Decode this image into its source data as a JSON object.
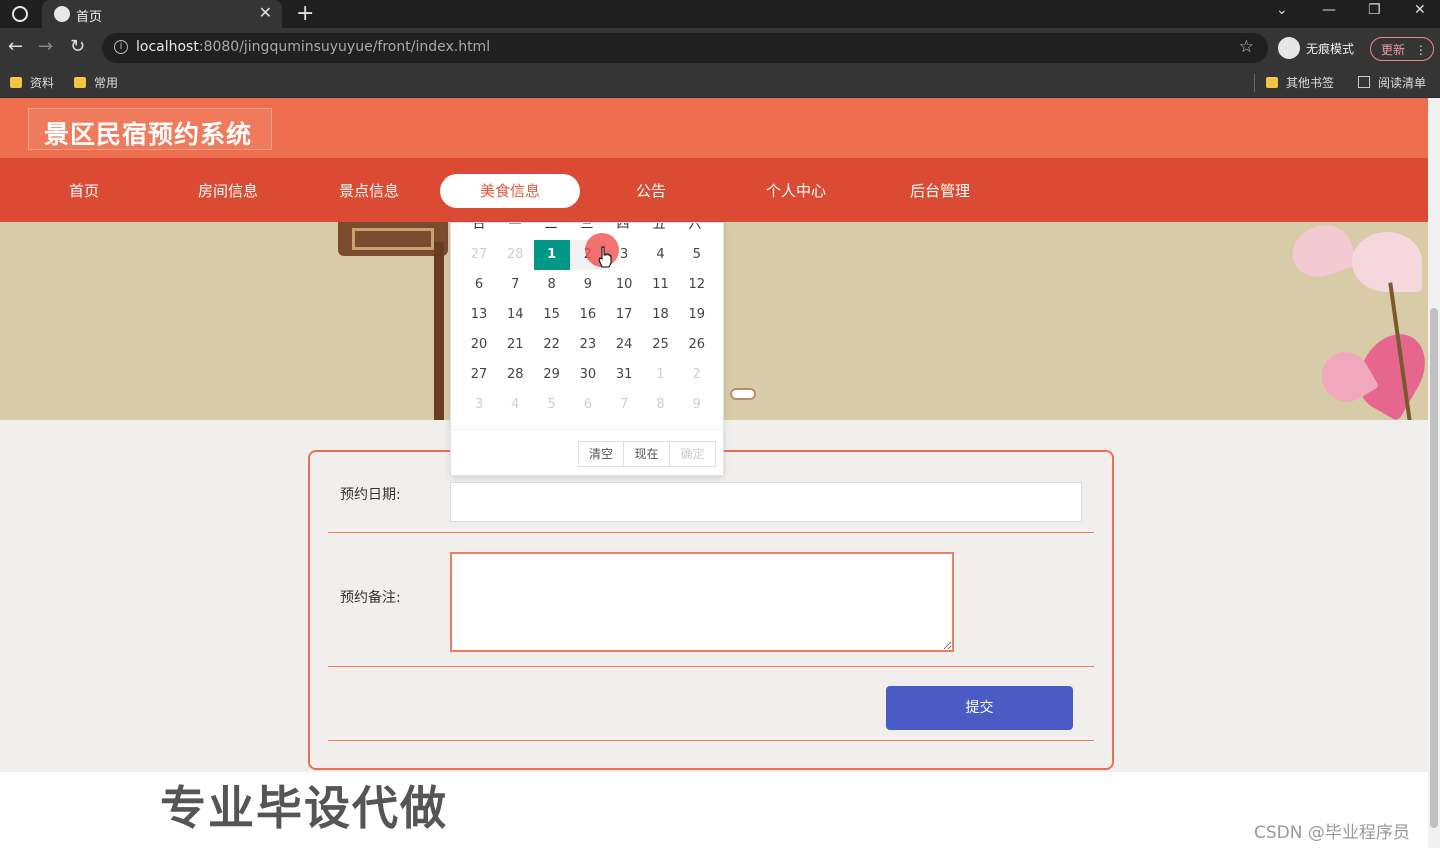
{
  "browser": {
    "tab_title": "首页",
    "url_host": "localhost",
    "url_rest": ":8080/jingquminsuyuyue/front/index.html",
    "incognito_label": "无痕模式",
    "update_label": "更新",
    "bookmarks": [
      "资料",
      "常用"
    ],
    "bookmarks_right": [
      "其他书签",
      "阅读清单"
    ]
  },
  "site": {
    "title": "景区民宿预约系统",
    "nav": [
      "首页",
      "房间信息",
      "景点信息",
      "美食信息",
      "公告",
      "个人中心",
      "后台管理"
    ],
    "active_nav": "美食信息"
  },
  "form": {
    "date_label": "预约日期:",
    "note_label": "预约备注:",
    "submit_label": "提交"
  },
  "calendar": {
    "weekdays": [
      "日",
      "一",
      "二",
      "三",
      "四",
      "五",
      "六"
    ],
    "rows": [
      [
        "27",
        "28",
        "1",
        "2",
        "3",
        "4",
        "5"
      ],
      [
        "6",
        "7",
        "8",
        "9",
        "10",
        "11",
        "12"
      ],
      [
        "13",
        "14",
        "15",
        "16",
        "17",
        "18",
        "19"
      ],
      [
        "20",
        "21",
        "22",
        "23",
        "24",
        "25",
        "26"
      ],
      [
        "27",
        "28",
        "29",
        "30",
        "31",
        "1",
        "2"
      ],
      [
        "3",
        "4",
        "5",
        "6",
        "7",
        "8",
        "9"
      ]
    ],
    "selected_day": "1",
    "buttons": {
      "clear": "清空",
      "now": "现在",
      "confirm": "确定"
    }
  },
  "watermarks": {
    "promo": "专业毕设代做",
    "csdn": "CSDN @毕业程序员"
  },
  "colors": {
    "header": "#ee6f4f",
    "nav": "#db4b34",
    "calendar_selected": "#009688",
    "submit": "#4a5bc6"
  }
}
